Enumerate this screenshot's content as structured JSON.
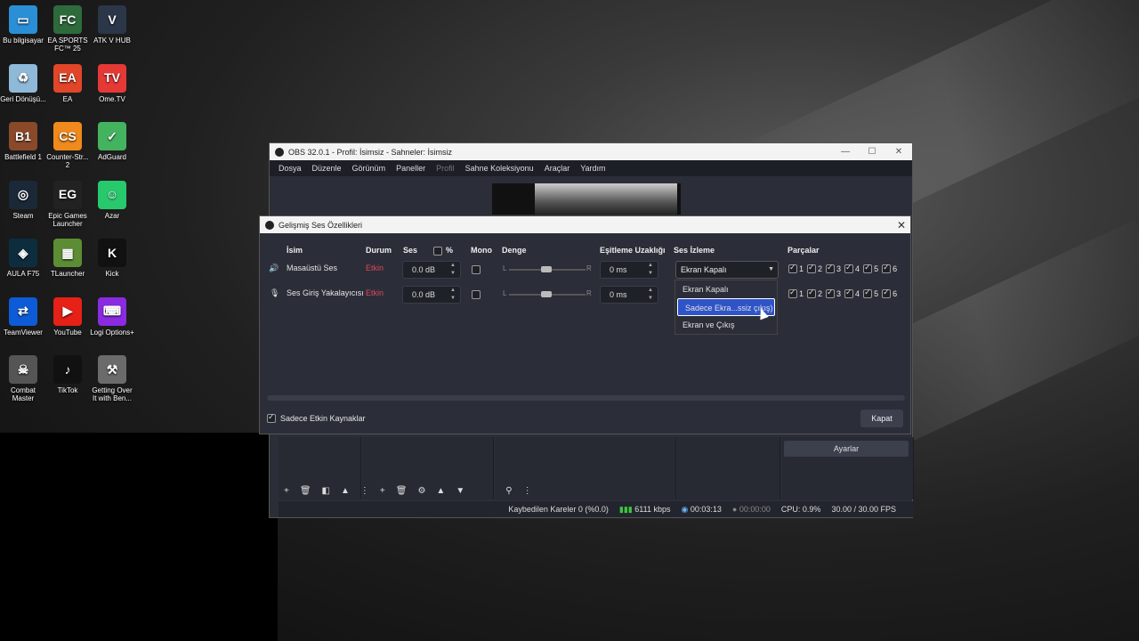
{
  "desktop": {
    "icons": [
      {
        "label": "Bu bilgisayar",
        "icon": "monitor-icon",
        "color": "#2a8fd6",
        "glyph": "▭"
      },
      {
        "label": "EA SPORTS FC™ 25",
        "icon": "ea-fc-icon",
        "color": "#2e6b3c",
        "glyph": "FC"
      },
      {
        "label": "ATK V HUB",
        "icon": "atk-icon",
        "color": "#2b3648",
        "glyph": "V"
      },
      {
        "label": "Geri Dönüşü...",
        "icon": "recycle-bin-icon",
        "color": "#8fb9d9",
        "glyph": "♻"
      },
      {
        "label": "EA",
        "icon": "ea-icon",
        "color": "#e2462a",
        "glyph": "EA"
      },
      {
        "label": "Ome.TV",
        "icon": "ometv-icon",
        "color": "#e53935",
        "glyph": "TV"
      },
      {
        "label": "Battlefield 1",
        "icon": "battlefield-icon",
        "color": "#8a4a2a",
        "glyph": "B1"
      },
      {
        "label": "Counter-Str... 2",
        "icon": "cs2-icon",
        "color": "#f08a1c",
        "glyph": "CS"
      },
      {
        "label": "AdGuard",
        "icon": "adguard-icon",
        "color": "#44b35f",
        "glyph": "✓"
      },
      {
        "label": "Steam",
        "icon": "steam-icon",
        "color": "#1b2838",
        "glyph": "◎"
      },
      {
        "label": "Epic Games Launcher",
        "icon": "epic-games-icon",
        "color": "#222222",
        "glyph": "EG"
      },
      {
        "label": "Azar",
        "icon": "azar-icon",
        "color": "#27c96c",
        "glyph": "☺"
      },
      {
        "label": "AULA F75",
        "icon": "aula-icon",
        "color": "#0d2d3f",
        "glyph": "◈"
      },
      {
        "label": "TLauncher",
        "icon": "tlauncher-icon",
        "color": "#5c8d34",
        "glyph": "▦"
      },
      {
        "label": "Kick",
        "icon": "kick-icon",
        "color": "#111111",
        "glyph": "K"
      },
      {
        "label": "TeamViewer",
        "icon": "teamviewer-icon",
        "color": "#0e5bd7",
        "glyph": "⇄"
      },
      {
        "label": "YouTube",
        "icon": "youtube-icon",
        "color": "#e62117",
        "glyph": "▶"
      },
      {
        "label": "Logi Options+",
        "icon": "logi-icon",
        "color": "#8a2be2",
        "glyph": "⌨"
      },
      {
        "label": "Combat Master",
        "icon": "combat-master-icon",
        "color": "#555555",
        "glyph": "☠"
      },
      {
        "label": "TikTok",
        "icon": "tiktok-icon",
        "color": "#111111",
        "glyph": "♪"
      },
      {
        "label": "Getting Over It with Ben...",
        "icon": "getting-over-it-icon",
        "color": "#6b6b6b",
        "glyph": "⚒"
      }
    ]
  },
  "obs": {
    "title": "OBS 32.0.1 - Profil: İsimsiz - Sahneler: İsimsiz",
    "menu": [
      "Dosya",
      "Düzenle",
      "Görünüm",
      "Paneller",
      "Profil",
      "Sahne Koleksiyonu",
      "Araçlar",
      "Yardım"
    ],
    "settings_button": "Ayarlar",
    "status": {
      "dropped": "Kaybedilen Kareler 0 (%0.0)",
      "bitrate": "6111 kbps",
      "rec_time": "00:03:13",
      "stream_time": "00:00:00",
      "cpu": "CPU: 0.9%",
      "fps": "30.00 / 30.00 FPS"
    }
  },
  "dialog": {
    "title": "Gelişmiş Ses Özellikleri",
    "headers": {
      "name": "İsim",
      "status": "Durum",
      "volume": "Ses",
      "percent": "%",
      "mono": "Mono",
      "balance": "Denge",
      "sync_offset": "Eşitleme Uzaklığı",
      "monitoring": "Ses İzleme",
      "tracks": "Parçalar"
    },
    "rows": [
      {
        "name": "Masaüstü Ses",
        "status": "Etkin",
        "volume": "0.0 dB",
        "balance_l": "L",
        "balance_r": "R",
        "offset": "0 ms",
        "monitoring": "Ekran Kapalı"
      },
      {
        "name": "Ses Giriş Yakalayıcısı",
        "status": "Etkin",
        "volume": "0.0 dB",
        "balance_l": "L",
        "balance_r": "R",
        "offset": "0 ms",
        "monitoring": ""
      }
    ],
    "track_numbers": [
      "1",
      "2",
      "3",
      "4",
      "5",
      "6"
    ],
    "monitoring_options": [
      "Ekran Kapalı",
      "Sadece Ekra...ssiz çıkış)",
      "Ekran ve Çıkış"
    ],
    "only_active_label": "Sadece Etkin Kaynaklar",
    "close_button": "Kapat",
    "status_color": "#e0455a",
    "accent": "#2f54c8"
  }
}
